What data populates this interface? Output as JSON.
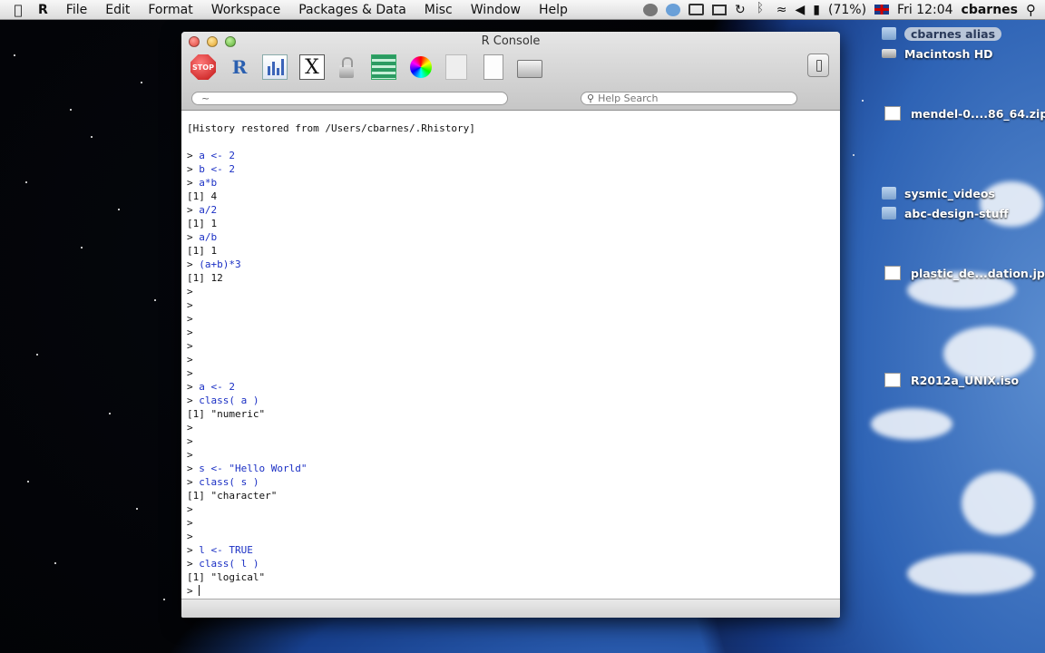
{
  "menubar": {
    "app": "R",
    "items": [
      "File",
      "Edit",
      "Format",
      "Workspace",
      "Packages & Data",
      "Misc",
      "Window",
      "Help"
    ],
    "battery": "(71%)",
    "clock": "Fri 12:04",
    "user": "cbarnes"
  },
  "desktop_items": [
    {
      "label": "cbarnes alias",
      "kind": "folder"
    },
    {
      "label": "Macintosh HD",
      "kind": "disk"
    },
    {
      "label": "mendel-0....86_64.zip",
      "kind": "doc"
    },
    {
      "label": "sysmic_videos",
      "kind": "folder"
    },
    {
      "label": "abc-design-stuff",
      "kind": "folder"
    },
    {
      "label": "plastic_de...dation.jpg",
      "kind": "doc"
    },
    {
      "label": "R2012a_UNIX.iso",
      "kind": "doc"
    }
  ],
  "window": {
    "title": "R Console",
    "toolbar": {
      "stop_label": "STOP",
      "x11_label": "X"
    },
    "directory": "~",
    "help_search_placeholder": "Help Search"
  },
  "console_lines": [
    {
      "type": "out",
      "text": "[History restored from /Users/cbarnes/.Rhistory]"
    },
    {
      "type": "blank",
      "text": ""
    },
    {
      "type": "in",
      "text": "a <- 2"
    },
    {
      "type": "in",
      "text": "b <- 2"
    },
    {
      "type": "in",
      "text": "a*b"
    },
    {
      "type": "out",
      "text": "[1] 4"
    },
    {
      "type": "in",
      "text": "a/2"
    },
    {
      "type": "out",
      "text": "[1] 1"
    },
    {
      "type": "in",
      "text": "a/b"
    },
    {
      "type": "out",
      "text": "[1] 1"
    },
    {
      "type": "in",
      "text": "(a+b)*3"
    },
    {
      "type": "out",
      "text": "[1] 12"
    },
    {
      "type": "in",
      "text": ""
    },
    {
      "type": "in",
      "text": ""
    },
    {
      "type": "in",
      "text": ""
    },
    {
      "type": "in",
      "text": ""
    },
    {
      "type": "in",
      "text": ""
    },
    {
      "type": "in",
      "text": ""
    },
    {
      "type": "in",
      "text": ""
    },
    {
      "type": "in",
      "text": "a <- 2"
    },
    {
      "type": "in",
      "text": "class( a )"
    },
    {
      "type": "out",
      "text": "[1] \"numeric\""
    },
    {
      "type": "in",
      "text": ""
    },
    {
      "type": "in",
      "text": ""
    },
    {
      "type": "in",
      "text": ""
    },
    {
      "type": "in",
      "text": "s <- \"Hello World\""
    },
    {
      "type": "in",
      "text": "class( s )"
    },
    {
      "type": "out",
      "text": "[1] \"character\""
    },
    {
      "type": "in",
      "text": ""
    },
    {
      "type": "in",
      "text": ""
    },
    {
      "type": "in",
      "text": ""
    },
    {
      "type": "in",
      "text": "l <- TRUE"
    },
    {
      "type": "in",
      "text": "class( l )"
    },
    {
      "type": "out",
      "text": "[1] \"logical\""
    },
    {
      "type": "prompt",
      "text": ""
    }
  ],
  "prompt": ">",
  "colors": {
    "input": "#1a2fc4",
    "output": "#111111"
  }
}
